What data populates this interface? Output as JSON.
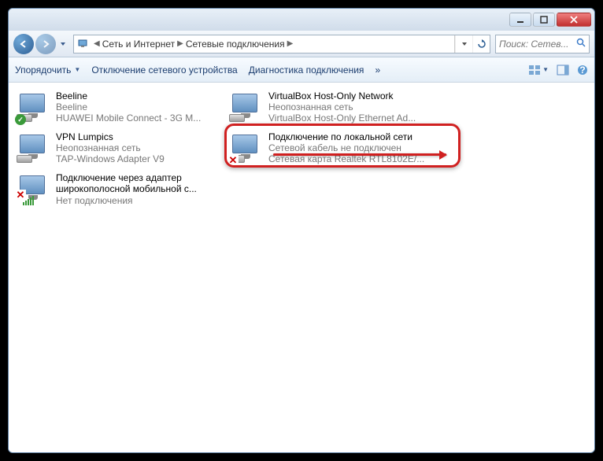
{
  "breadcrumbs": {
    "item1": "Сеть и Интернет",
    "item2": "Сетевые подключения"
  },
  "search": {
    "placeholder": "Поиск: Сетев..."
  },
  "toolbar": {
    "organize": "Упорядочить",
    "disable": "Отключение сетевого устройства",
    "diagnose": "Диагностика подключения",
    "more": "»"
  },
  "connections": [
    {
      "title": "Beeline",
      "sub1": "Beeline",
      "sub2": "HUAWEI Mobile Connect - 3G M...",
      "badge": "ok"
    },
    {
      "title": "VirtualBox Host-Only Network",
      "sub1": "Неопознанная сеть",
      "sub2": "VirtualBox Host-Only Ethernet Ad...",
      "badge": ""
    },
    {
      "title": "VPN Lumpics",
      "sub1": "Неопознанная сеть",
      "sub2": "TAP-Windows Adapter V9",
      "badge": ""
    },
    {
      "title": "Подключение по локальной сети",
      "sub1": "Сетевой кабель не подключен",
      "sub2": "Сетевая карта Realtek RTL8102E/...",
      "badge": "x"
    },
    {
      "title": "Подключение через адаптер широкополосной мобильной с...",
      "sub1": "",
      "sub2": "Нет подключения",
      "badge": "bars"
    }
  ]
}
